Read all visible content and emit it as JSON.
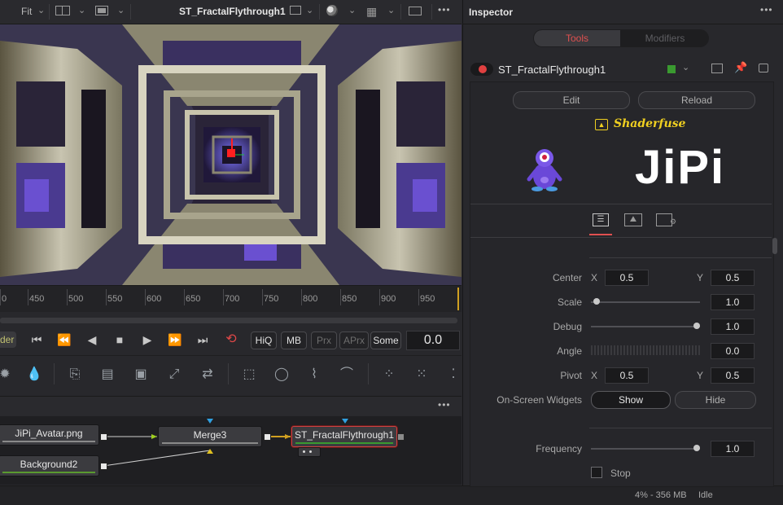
{
  "viewer": {
    "fit_label": "Fit",
    "title": "ST_FractalFlythrough1",
    "more": "•••"
  },
  "ruler": {
    "labels": [
      "0",
      "450",
      "500",
      "550",
      "600",
      "650",
      "700",
      "750",
      "800",
      "850",
      "900",
      "950"
    ]
  },
  "transport": {
    "render_label": "der",
    "hiq": "HiQ",
    "mb": "MB",
    "prx": "Prx",
    "aprx": "APrx",
    "some": "Some",
    "frame": "0.0"
  },
  "node_editor": {
    "more": "•••",
    "nodes": {
      "jipi": "JiPi_Avatar.png",
      "merge": "Merge3",
      "shader": "ST_FractalFlythrough1",
      "background": "Background2"
    }
  },
  "status": {
    "memory": "4% - 356 MB",
    "state": "Idle"
  },
  "inspector": {
    "title": "Inspector",
    "more": "•••",
    "tabs": [
      "Tools",
      "Modifiers"
    ],
    "tool_name": "ST_FractalFlythrough1",
    "edit": "Edit",
    "reload": "Reload",
    "brand": "Shaderfuse",
    "logo_text": "JiPi",
    "params": {
      "center": {
        "label": "Center",
        "x_label": "X",
        "x": "0.5",
        "y_label": "Y",
        "y": "0.5"
      },
      "scale": {
        "label": "Scale",
        "value": "1.0",
        "level": 0.05
      },
      "debug": {
        "label": "Debug",
        "value": "1.0",
        "level": 1.0
      },
      "angle": {
        "label": "Angle",
        "value": "0.0"
      },
      "pivot": {
        "label": "Pivot",
        "x_label": "X",
        "x": "0.5",
        "y_label": "Y",
        "y": "0.5"
      },
      "widgets": {
        "label": "On-Screen Widgets",
        "show": "Show",
        "hide": "Hide"
      },
      "frequency": {
        "label": "Frequency",
        "value": "1.0",
        "level": 1.0
      },
      "stop": {
        "label": "Stop"
      }
    }
  },
  "colors": {
    "accent_red": "#e05050",
    "brand_yellow": "#f0d020",
    "tool_green": "#3a9a30",
    "selected_node": "#d04040"
  }
}
